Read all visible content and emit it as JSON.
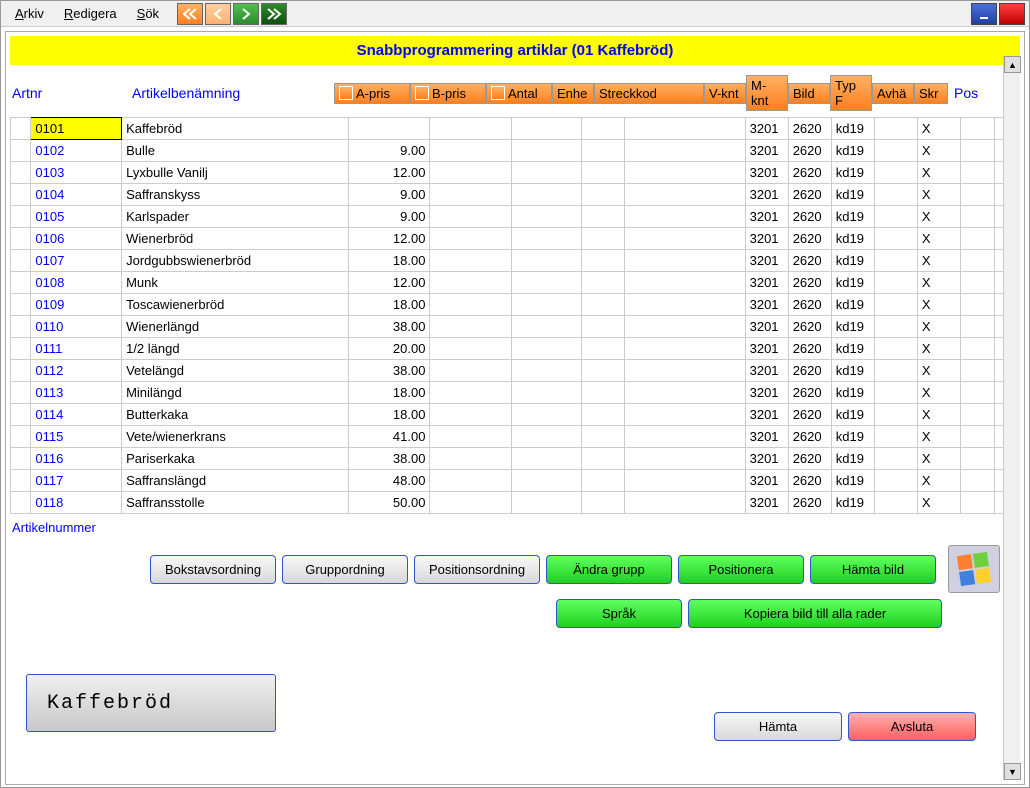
{
  "menu": {
    "arkiv": "Arkiv",
    "redigera": "Redigera",
    "sok": "Sök"
  },
  "title": "Snabbprogrammering artiklar (01 Kaffebröd)",
  "labels": {
    "artnr": "Artnr",
    "artben": "Artikelbenämning",
    "pos": "Pos",
    "artikelnummer": "Artikelnummer"
  },
  "headers": {
    "apris": "A-pris",
    "bpris": "B-pris",
    "antal": "Antal",
    "enh": "Enhe",
    "streck": "Streckkod",
    "vknt": "V-knt",
    "mknt": "M-knt",
    "bild": "Bild",
    "typf": "Typ F",
    "avha": "Avhä",
    "skr": "Skr"
  },
  "rows": [
    {
      "art": "0101",
      "name": "Kaffebröd",
      "apris": "",
      "vknt": "3201",
      "mknt": "2620",
      "bild": "kd19",
      "avha": "X"
    },
    {
      "art": "0102",
      "name": "Bulle",
      "apris": "9.00",
      "vknt": "3201",
      "mknt": "2620",
      "bild": "kd19",
      "avha": "X"
    },
    {
      "art": "0103",
      "name": "Lyxbulle Vanilj",
      "apris": "12.00",
      "vknt": "3201",
      "mknt": "2620",
      "bild": "kd19",
      "avha": "X"
    },
    {
      "art": "0104",
      "name": "Saffranskyss",
      "apris": "9.00",
      "vknt": "3201",
      "mknt": "2620",
      "bild": "kd19",
      "avha": "X"
    },
    {
      "art": "0105",
      "name": "Karlspader",
      "apris": "9.00",
      "vknt": "3201",
      "mknt": "2620",
      "bild": "kd19",
      "avha": "X"
    },
    {
      "art": "0106",
      "name": "Wienerbröd",
      "apris": "12.00",
      "vknt": "3201",
      "mknt": "2620",
      "bild": "kd19",
      "avha": "X"
    },
    {
      "art": "0107",
      "name": "Jordgubbswienerbröd",
      "apris": "18.00",
      "vknt": "3201",
      "mknt": "2620",
      "bild": "kd19",
      "avha": "X"
    },
    {
      "art": "0108",
      "name": "Munk",
      "apris": "12.00",
      "vknt": "3201",
      "mknt": "2620",
      "bild": "kd19",
      "avha": "X"
    },
    {
      "art": "0109",
      "name": "Toscawienerbröd",
      "apris": "18.00",
      "vknt": "3201",
      "mknt": "2620",
      "bild": "kd19",
      "avha": "X"
    },
    {
      "art": "0110",
      "name": "Wienerlängd",
      "apris": "38.00",
      "vknt": "3201",
      "mknt": "2620",
      "bild": "kd19",
      "avha": "X"
    },
    {
      "art": "0111",
      "name": "1/2 längd",
      "apris": "20.00",
      "vknt": "3201",
      "mknt": "2620",
      "bild": "kd19",
      "avha": "X"
    },
    {
      "art": "0112",
      "name": "Vetelängd",
      "apris": "38.00",
      "vknt": "3201",
      "mknt": "2620",
      "bild": "kd19",
      "avha": "X"
    },
    {
      "art": "0113",
      "name": "Minilängd",
      "apris": "18.00",
      "vknt": "3201",
      "mknt": "2620",
      "bild": "kd19",
      "avha": "X"
    },
    {
      "art": "0114",
      "name": "Butterkaka",
      "apris": "18.00",
      "vknt": "3201",
      "mknt": "2620",
      "bild": "kd19",
      "avha": "X"
    },
    {
      "art": "0115",
      "name": "Vete/wienerkrans",
      "apris": "41.00",
      "vknt": "3201",
      "mknt": "2620",
      "bild": "kd19",
      "avha": "X"
    },
    {
      "art": "0116",
      "name": "Pariserkaka",
      "apris": "38.00",
      "vknt": "3201",
      "mknt": "2620",
      "bild": "kd19",
      "avha": "X"
    },
    {
      "art": "0117",
      "name": "Saffranslängd",
      "apris": "48.00",
      "vknt": "3201",
      "mknt": "2620",
      "bild": "kd19",
      "avha": "X"
    },
    {
      "art": "0118",
      "name": "Saffransstolle",
      "apris": "50.00",
      "vknt": "3201",
      "mknt": "2620",
      "bild": "kd19",
      "avha": "X"
    }
  ],
  "buttons": {
    "bokstav": "Bokstavsordning",
    "grupp": "Gruppordning",
    "position": "Positionsordning",
    "andra": "Ändra grupp",
    "positionera": "Positionera",
    "hamta_bild": "Hämta bild",
    "sprak": "Språk",
    "kopiera": "Kopiera bild till alla rader",
    "hamta": "Hämta",
    "avsluta": "Avsluta"
  },
  "preview": "Kaffebröd"
}
